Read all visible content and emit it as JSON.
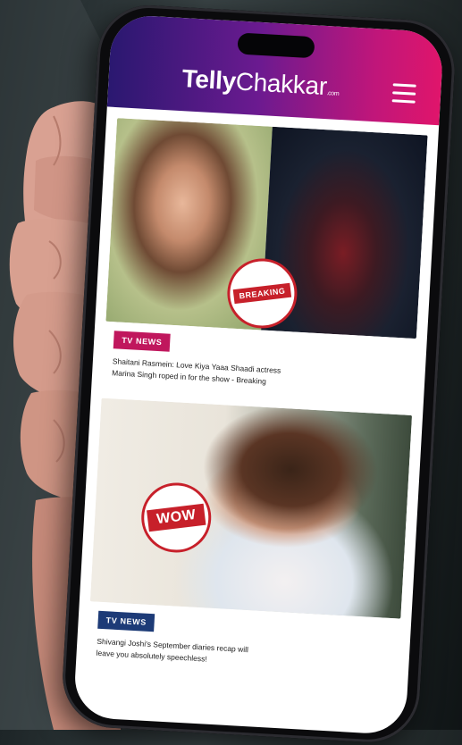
{
  "header": {
    "brand_bold": "Telly",
    "brand_light": "Chakkar",
    "brand_suffix": ".com"
  },
  "feed": [
    {
      "badge": "BREAKING",
      "category": "TV NEWS",
      "category_color": "#c0175d",
      "headline": "Shaitani Rasmein: Love Kiya Yaaa Shaadi actress Marina Singh roped in for the show - Breaking"
    },
    {
      "badge": "WOW",
      "category": "TV NEWS",
      "category_color": "#1d3b77",
      "headline": "Shivangi Joshi's September diaries recap will leave you absolutely speechless!"
    }
  ],
  "colors": {
    "header_gradient_start": "#2a1870",
    "header_gradient_end": "#e0156b",
    "badge_red": "#c7202a"
  },
  "icons": {
    "menu": "hamburger-menu-icon"
  }
}
